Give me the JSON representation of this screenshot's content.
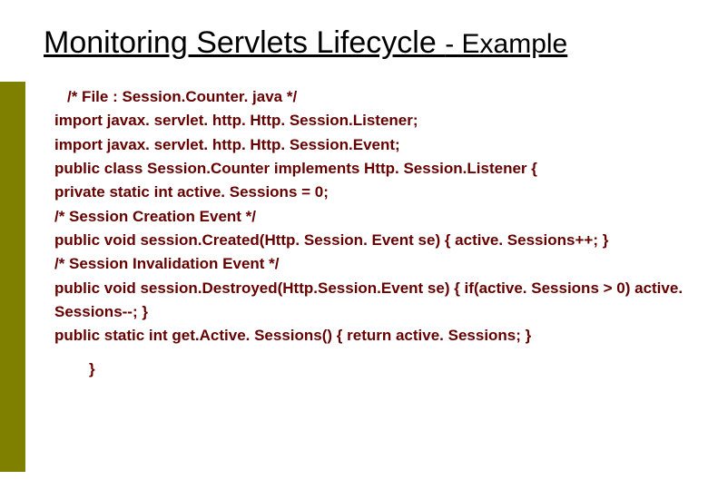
{
  "title": {
    "main": "Monitoring Servlets Lifecycle ",
    "suffix": "- Example"
  },
  "code": {
    "l1": "/* File : Session.Counter. java */",
    "l2": "import javax. servlet. http. Http. Session.Listener;",
    "l3": "import javax. servlet. http. Http. Session.Event;",
    "l4": "public class Session.Counter implements Http. Session.Listener {",
    "l5": "private static int active. Sessions = 0;",
    "l6": "/* Session Creation Event */",
    "l7": "public void session.Created(Http. Session. Event se) { active. Sessions++; }",
    "l8": "/* Session Invalidation Event */",
    "l9": "public void session.Destroyed(Http.Session.Event se) { if(active. Sessions > 0) active. Sessions--; }",
    "l10": "public static int get.Active. Sessions() { return active. Sessions; }",
    "l11": "}"
  }
}
